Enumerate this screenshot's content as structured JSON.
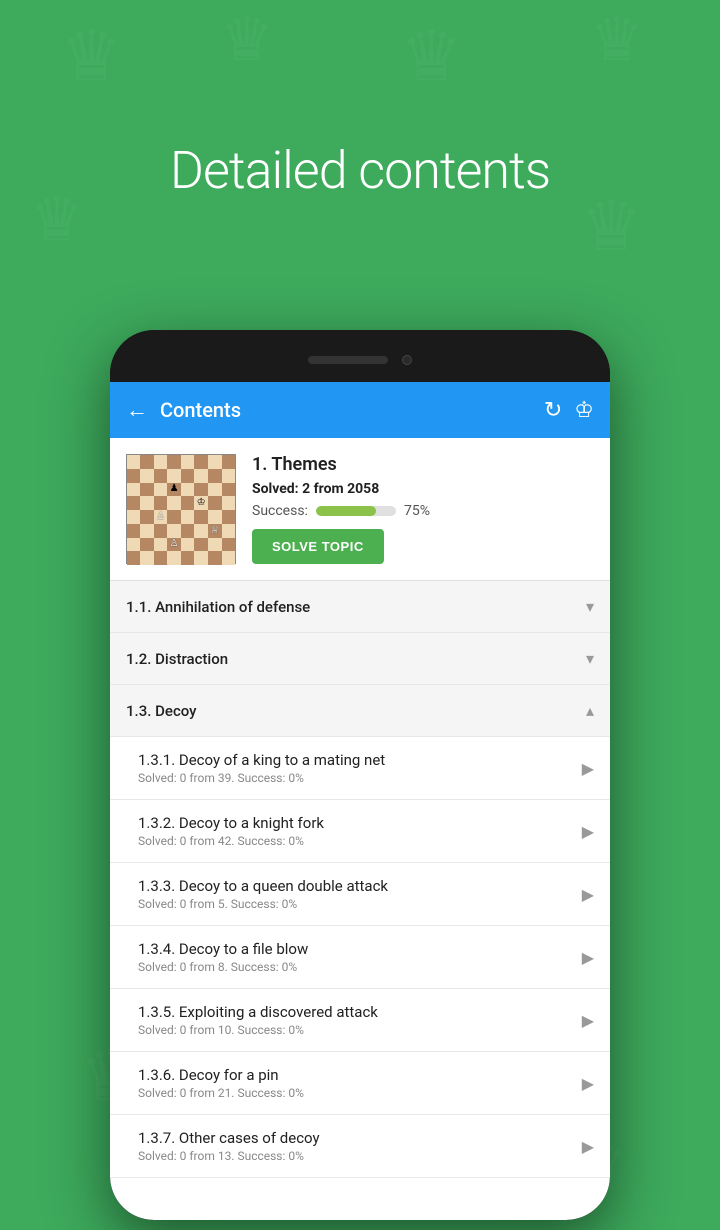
{
  "page": {
    "background_color": "#3daa5c",
    "main_title": "Detailed contents"
  },
  "appbar": {
    "title": "Contents",
    "back_icon": "←",
    "refresh_icon": "↻",
    "logo_icon": "♔"
  },
  "theme": {
    "title": "1. Themes",
    "solved_label": "Solved:",
    "solved_count": "2",
    "solved_from": "from",
    "solved_total": "2058",
    "success_label": "Success:",
    "success_percent": "75%",
    "progress_width": 75,
    "solve_button": "SOLVE TOPIC"
  },
  "items": [
    {
      "id": "1.1",
      "title": "1.1. Annihilation of defense",
      "subtitle": "",
      "type": "section",
      "expanded": false,
      "icon": "chevron-down"
    },
    {
      "id": "1.2",
      "title": "1.2. Distraction",
      "subtitle": "",
      "type": "section",
      "expanded": false,
      "icon": "chevron-down"
    },
    {
      "id": "1.3",
      "title": "1.3. Decoy",
      "subtitle": "",
      "type": "section",
      "expanded": true,
      "icon": "chevron-up"
    },
    {
      "id": "1.3.1",
      "title": "1.3.1. Decoy of a king to a mating net",
      "subtitle": "Solved: 0 from 39. Success: 0%",
      "type": "subsection",
      "icon": "play"
    },
    {
      "id": "1.3.2",
      "title": "1.3.2. Decoy to a knight fork",
      "subtitle": "Solved: 0 from 42. Success: 0%",
      "type": "subsection",
      "icon": "play"
    },
    {
      "id": "1.3.3",
      "title": "1.3.3. Decoy to a queen double attack",
      "subtitle": "Solved: 0 from 5. Success: 0%",
      "type": "subsection",
      "icon": "play"
    },
    {
      "id": "1.3.4",
      "title": "1.3.4. Decoy to a file blow",
      "subtitle": "Solved: 0 from 8. Success: 0%",
      "type": "subsection",
      "icon": "play"
    },
    {
      "id": "1.3.5",
      "title": "1.3.5. Exploiting a discovered attack",
      "subtitle": "Solved: 0 from 10. Success: 0%",
      "type": "subsection",
      "icon": "play"
    },
    {
      "id": "1.3.6",
      "title": "1.3.6. Decoy for a pin",
      "subtitle": "Solved: 0 from 21. Success: 0%",
      "type": "subsection",
      "icon": "play"
    },
    {
      "id": "1.3.7",
      "title": "1.3.7. Other cases of decoy",
      "subtitle": "Solved: 0 from 13. Success: 0%",
      "type": "subsection",
      "icon": "play"
    }
  ]
}
